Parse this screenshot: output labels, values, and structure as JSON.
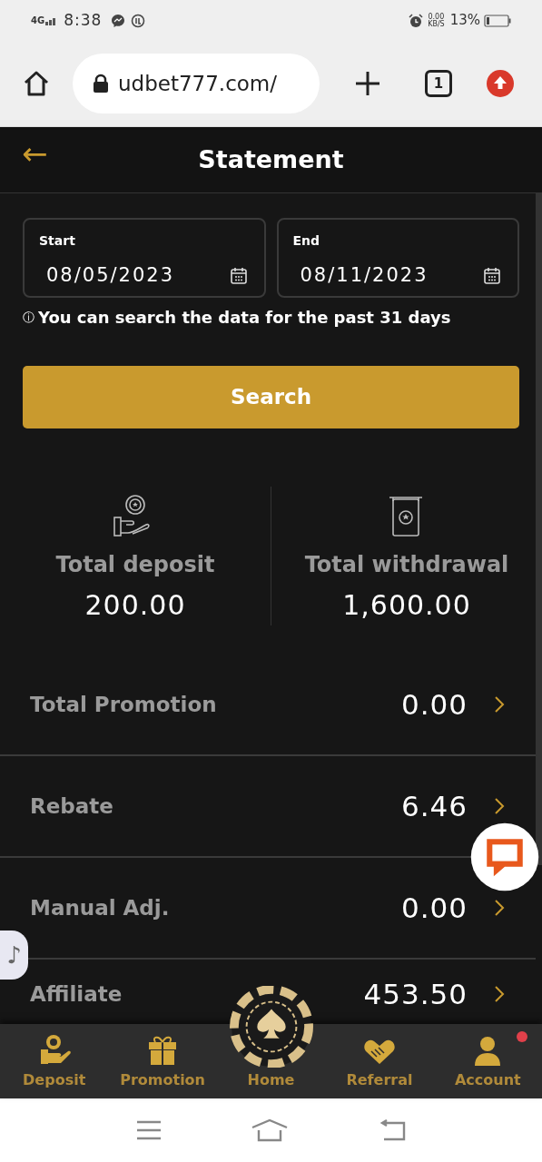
{
  "status_bar": {
    "network": "4G",
    "time": "8:38",
    "speed": "0.00",
    "speed_unit": "KB/S",
    "battery": "13%"
  },
  "browser": {
    "url": "udbet777.com/",
    "tab_count": "1"
  },
  "header": {
    "back_icon": "←",
    "title": "Statement"
  },
  "date_range": [
    {
      "label": "Start",
      "value": "08/05/2023"
    },
    {
      "label": "End",
      "value": "08/11/2023"
    }
  ],
  "info_icon": "ⓘ",
  "note": "You can search the data for the past 31 days",
  "search_button": "Search",
  "totals": [
    {
      "kind": "deposit",
      "label": "Total deposit",
      "value": "200.00"
    },
    {
      "kind": "withdrawal",
      "label": "Total withdrawal",
      "value": "1,600.00"
    }
  ],
  "rows": [
    {
      "label": "Total Promotion",
      "value": "0.00"
    },
    {
      "label": "Rebate",
      "value": "6.46"
    },
    {
      "label": "Manual Adj.",
      "value": "0.00"
    },
    {
      "label": "Affiliate",
      "value": "453.50"
    }
  ],
  "music_icon": "♪",
  "bottom_nav": [
    {
      "kind": "deposit",
      "label": "Deposit",
      "badge": false
    },
    {
      "kind": "promotion",
      "label": "Promotion",
      "badge": false
    },
    {
      "kind": "home",
      "label": "Home",
      "badge": false
    },
    {
      "kind": "referral",
      "label": "Referral",
      "badge": false
    },
    {
      "kind": "account",
      "label": "Account",
      "badge": true
    }
  ]
}
